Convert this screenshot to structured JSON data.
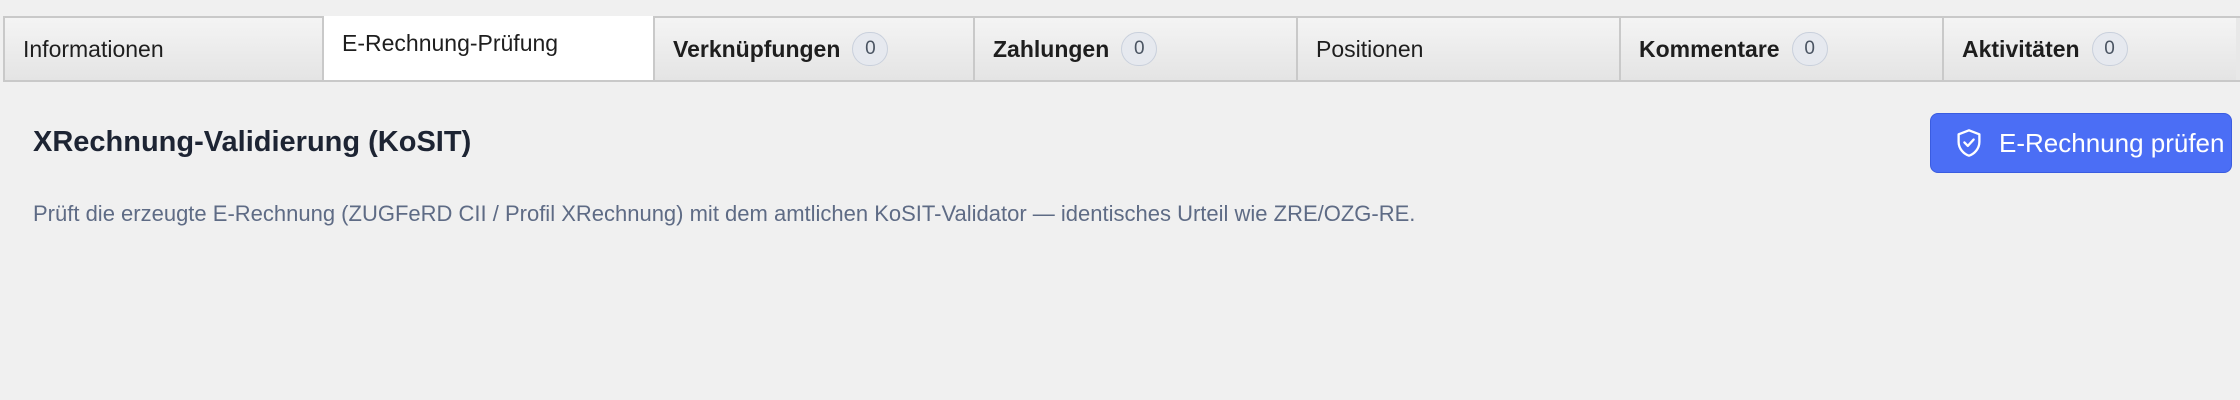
{
  "tabs": [
    {
      "label": "Informationen",
      "count": null,
      "bold": false,
      "active": false
    },
    {
      "label": "E-Rechnung-Prüfung",
      "count": null,
      "bold": false,
      "active": true
    },
    {
      "label": "Verknüpfungen",
      "count": "0",
      "bold": true,
      "active": false
    },
    {
      "label": "Zahlungen",
      "count": "0",
      "bold": true,
      "active": false
    },
    {
      "label": "Positionen",
      "count": null,
      "bold": false,
      "active": false
    },
    {
      "label": "Kommentare",
      "count": "0",
      "bold": true,
      "active": false
    },
    {
      "label": "Aktivitäten",
      "count": "0",
      "bold": true,
      "active": false
    }
  ],
  "section": {
    "title": "XRechnung-Validierung (KoSIT)",
    "description": "Prüft die erzeugte E-Rechnung (ZUGFeRD CII / Profil XRechnung) mit dem amtlichen KoSIT-Validator — identisches Urteil wie ZRE/OZG-RE."
  },
  "action_button": {
    "label": "E-Rechnung prüfen",
    "icon": "shield-check-icon",
    "color": "#4b6ef5"
  }
}
